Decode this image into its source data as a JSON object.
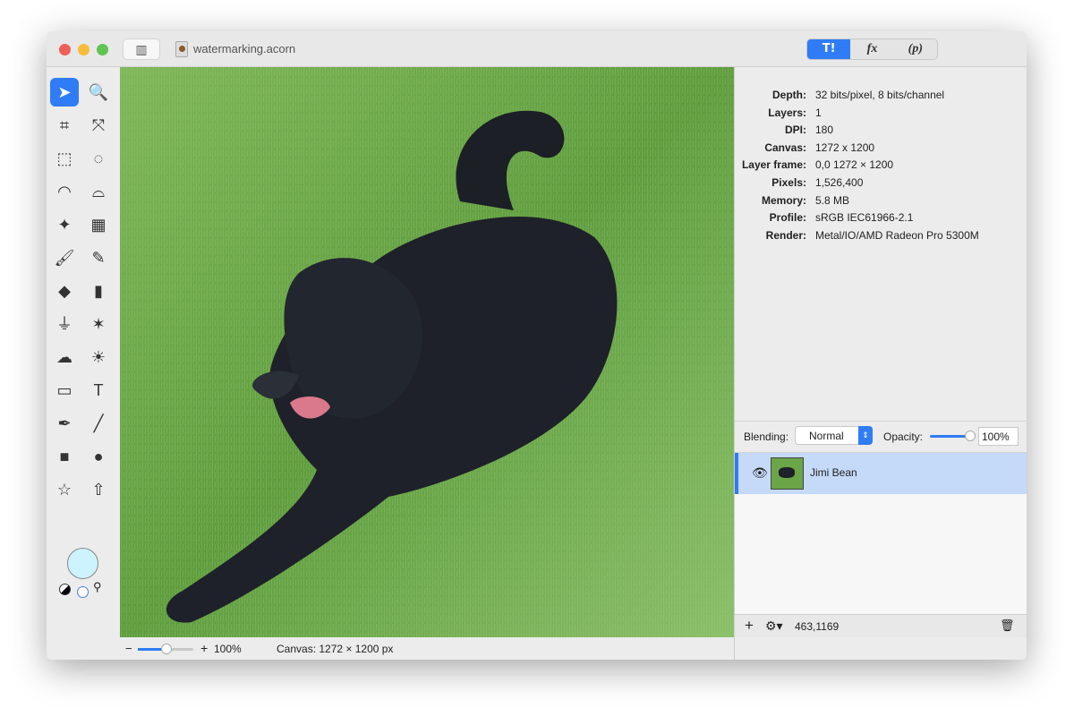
{
  "window": {
    "title": "watermarking.acorn",
    "traffic_colors": [
      "#ee5f57",
      "#f6bd3b",
      "#5fc454"
    ]
  },
  "inspector_tabs": [
    {
      "label": "T!",
      "icon": "tools-icon",
      "active": true
    },
    {
      "label": "fx",
      "icon": "fx-icon"
    },
    {
      "label": "(p)",
      "icon": "properties-icon"
    }
  ],
  "tools": [
    {
      "name": "select-arrow",
      "glyph": "➤"
    },
    {
      "name": "zoom",
      "glyph": "🔍"
    },
    {
      "name": "crop",
      "glyph": "⌗"
    },
    {
      "name": "transform",
      "glyph": "⤧"
    },
    {
      "name": "rect-select",
      "glyph": "⬚"
    },
    {
      "name": "ellipse-select",
      "glyph": "◌"
    },
    {
      "name": "lasso",
      "glyph": "◠"
    },
    {
      "name": "polygon-lasso",
      "glyph": "⌓"
    },
    {
      "name": "magic-wand",
      "glyph": "✦"
    },
    {
      "name": "instant-alpha",
      "glyph": "▦"
    },
    {
      "name": "brush",
      "glyph": "🖌"
    },
    {
      "name": "pencil",
      "glyph": "✎"
    },
    {
      "name": "paint-bucket",
      "glyph": "◆"
    },
    {
      "name": "eraser",
      "glyph": "▮"
    },
    {
      "name": "stamp",
      "glyph": "⏚"
    },
    {
      "name": "smudge",
      "glyph": "✶"
    },
    {
      "name": "cloud",
      "glyph": "☁"
    },
    {
      "name": "brightness",
      "glyph": "☀"
    },
    {
      "name": "gradient",
      "glyph": "▭"
    },
    {
      "name": "text",
      "glyph": "T"
    },
    {
      "name": "pen",
      "glyph": "✒"
    },
    {
      "name": "line",
      "glyph": "╱"
    },
    {
      "name": "rectangle",
      "glyph": "■"
    },
    {
      "name": "oval",
      "glyph": "●"
    },
    {
      "name": "star",
      "glyph": "☆"
    },
    {
      "name": "arrow",
      "glyph": "⇧"
    }
  ],
  "color_well": "#cdf3ff",
  "info": [
    {
      "k": "Depth:",
      "v": "32 bits/pixel, 8 bits/channel"
    },
    {
      "k": "Layers:",
      "v": "1"
    },
    {
      "k": "DPI:",
      "v": "180"
    },
    {
      "k": "Canvas:",
      "v": "1272 x 1200"
    },
    {
      "k": "Layer frame:",
      "v": "0,0 1272 × 1200"
    },
    {
      "k": "Pixels:",
      "v": "1,526,400"
    },
    {
      "k": "Memory:",
      "v": "5.8 MB"
    },
    {
      "k": "Profile:",
      "v": "sRGB IEC61966-2.1"
    },
    {
      "k": "Render:",
      "v": "Metal/IO/AMD Radeon Pro 5300M"
    }
  ],
  "blending": {
    "label": "Blending:",
    "value": "Normal",
    "opacity_label": "Opacity:",
    "opacity": "100%",
    "opacity_fraction": 1.0
  },
  "layers": [
    {
      "name": "Jimi Bean",
      "visible": true
    }
  ],
  "layer_footer": {
    "coords": "463,1169"
  },
  "bottom": {
    "zoom": "100%",
    "canvas": "Canvas: 1272 × 1200 px",
    "minus": "−",
    "plus": "+"
  }
}
